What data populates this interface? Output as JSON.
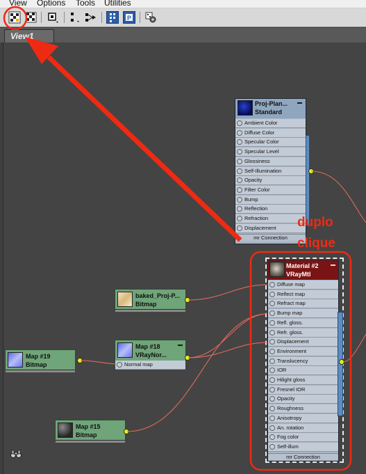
{
  "menu": [
    "View",
    "Options",
    "Tools",
    "Utilities"
  ],
  "tab": {
    "label": "View1"
  },
  "nodes": {
    "proj_plan": {
      "title1": "Proj-Plan...",
      "title2": "Standard",
      "slots": [
        "Ambient Color",
        "Diffuse Color",
        "Specular Color",
        "Specular Level",
        "Glossiness",
        "Self-Illumination",
        "Opacity",
        "Filter Color",
        "Bump",
        "Reflection",
        "Refraction",
        "Displacement"
      ],
      "footer": "mr Connection"
    },
    "material2": {
      "title1": "Material #2",
      "title2": "VRayMtl",
      "slots": [
        "Diffuse map",
        "Reflect map",
        "Refract map",
        "Bump map",
        "Refl. gloss.",
        "Refr. gloss.",
        "Displacement",
        "Environment",
        "Translucency",
        "IOR",
        "Hilight gloss",
        "Fresnel IOR",
        "Opacity",
        "Roughness",
        "Anisotropy",
        "An. rotation",
        "Fog color",
        "Self-illum"
      ],
      "footer": "mr Connection"
    },
    "baked": {
      "title1": "baked_Proj-P...",
      "title2": "Bitmap"
    },
    "map19": {
      "title1": "Map #19",
      "title2": "Bitmap"
    },
    "map18": {
      "title1": "Map #18",
      "title2": "VRayNor...",
      "slot": "Normal map"
    },
    "map15": {
      "title1": "Map #15",
      "title2": "Bitmap"
    }
  },
  "annotation": {
    "line1": "duplo",
    "line2": "clique",
    "color": "#ef2a12"
  },
  "icons": [
    "material-map-browser-icon",
    "checker-icon",
    "move-icon",
    "layout-icon",
    "hierarchy-icon",
    "select-icon",
    "show-icon",
    "options-icon",
    "binoculars-icon"
  ]
}
